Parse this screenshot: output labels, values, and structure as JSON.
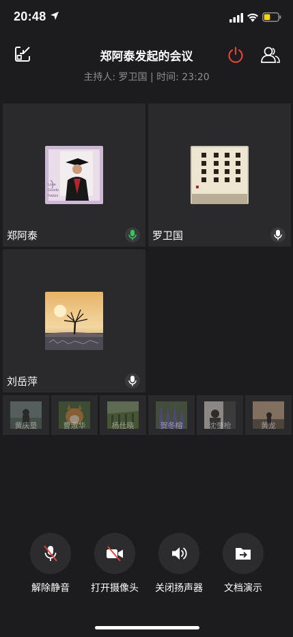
{
  "status_bar": {
    "time": "20:48"
  },
  "header": {
    "title": "郑阿泰发起的会议",
    "host_label": "主持人: 罗卫国",
    "separator": " | ",
    "time_label": "时间: 23:20",
    "power_color": "#e0453a"
  },
  "participants": [
    {
      "name": "郑阿泰",
      "mic_state": "speaking",
      "mic_color": "#34c759",
      "avatar": "graduation-photo"
    },
    {
      "name": "罗卫国",
      "mic_state": "on",
      "mic_color": "#ffffff",
      "avatar": "calligraphy"
    },
    {
      "name": "刘岳萍",
      "mic_state": "on",
      "mic_color": "#ffffff",
      "avatar": "sunset-tree"
    }
  ],
  "thumbnails": [
    {
      "name": "黄庆垦"
    },
    {
      "name": "曹淑华"
    },
    {
      "name": "杨仕晓"
    },
    {
      "name": "贺冬榕"
    },
    {
      "name": "沈奎枪"
    },
    {
      "name": "黄龙"
    }
  ],
  "controls": [
    {
      "label": "解除静音",
      "icon": "mic-muted-icon"
    },
    {
      "label": "打开摄像头",
      "icon": "camera-off-icon"
    },
    {
      "label": "关闭扬声器",
      "icon": "speaker-icon"
    },
    {
      "label": "文档演示",
      "icon": "share-doc-icon"
    }
  ]
}
